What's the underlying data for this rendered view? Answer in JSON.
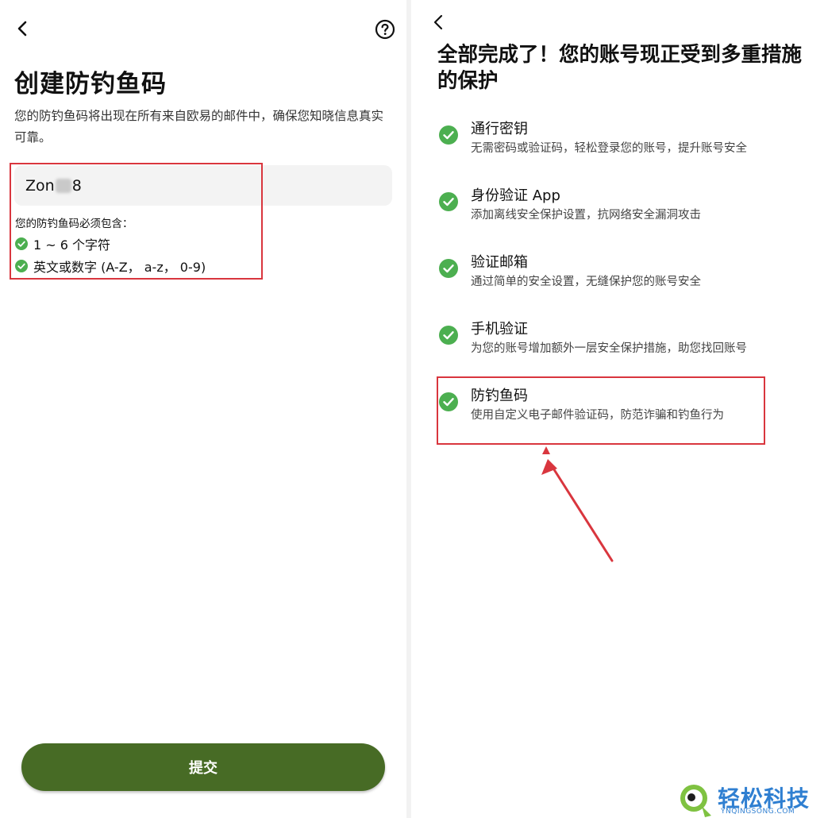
{
  "left": {
    "title": "创建防钓鱼码",
    "description": "您的防钓鱼码将出现在所有来自欧易的邮件中，确保您知晓信息真实可靠。",
    "input": {
      "value_prefix": "Zon",
      "value_suffix": "8"
    },
    "requirements_title": "您的防钓鱼码必须包含：",
    "requirements": [
      {
        "label": "1 ~ 6 个字符"
      },
      {
        "label": "英文或数字 (A-Z， a-z， 0-9)"
      }
    ],
    "submit_label": "提交"
  },
  "right": {
    "title": "全部完成了！您的账号现正受到多重措施的保护",
    "features": [
      {
        "title": "通行密钥",
        "desc": "无需密码或验证码，轻松登录您的账号，提升账号安全"
      },
      {
        "title": "身份验证 App",
        "desc": "添加离线安全保护设置，抗网络安全漏洞攻击"
      },
      {
        "title": "验证邮箱",
        "desc": "通过简单的安全设置，无缝保护您的账号安全"
      },
      {
        "title": "手机验证",
        "desc": "为您的账号增加额外一层安全保护措施，助您找回账号"
      },
      {
        "title": "防钓鱼码",
        "desc": "使用自定义电子邮件验证码，防范诈骗和钓鱼行为"
      }
    ]
  },
  "watermark": {
    "name": "轻松科技",
    "url": "YNQINGSONG.COM"
  },
  "colors": {
    "accent_green": "#476b25",
    "check_green": "#4caf50",
    "highlight_red": "#d9363e",
    "watermark_blue": "#2f7fd1"
  },
  "icons": {
    "back": "chevron-left-icon",
    "help": "question-circle-icon",
    "check": "check-circle-icon"
  }
}
